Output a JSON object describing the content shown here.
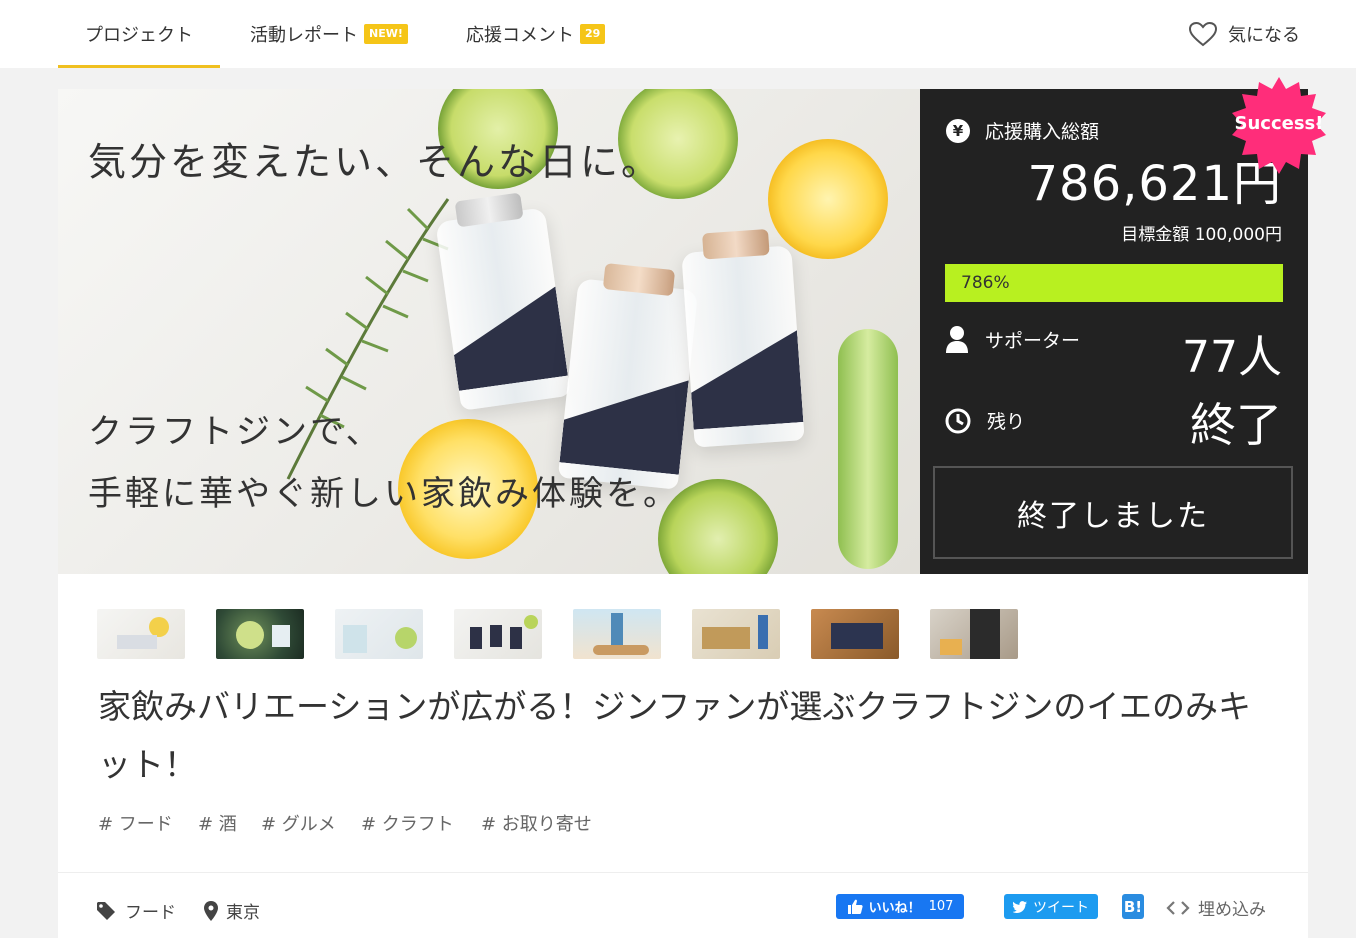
{
  "nav": {
    "tabs": [
      {
        "label": "プロジェクト"
      },
      {
        "label": "活動レポート",
        "badge": "NEW!"
      },
      {
        "label": "応援コメント",
        "badge": "29"
      }
    ],
    "favorite_label": "気になる"
  },
  "hero": {
    "headline": "気分を変えたい、そんな日に。",
    "line1": "クラフトジンで、",
    "line2": "手軽に華やぐ新しい家飲み体験を。"
  },
  "stats": {
    "total_label": "応援購入総額",
    "total_value": "786,621円",
    "goal_text": "目標金額 100,000円",
    "percent_text": "786%",
    "supporters_label": "サポーター",
    "supporters_value": "77人",
    "remaining_label": "残り",
    "remaining_value": "終了",
    "ended_button": "終了しました",
    "success_badge": "Success!"
  },
  "thumbnails": [
    {
      "name": "thumbnail-1"
    },
    {
      "name": "thumbnail-2"
    },
    {
      "name": "thumbnail-3"
    },
    {
      "name": "thumbnail-4"
    },
    {
      "name": "thumbnail-5"
    },
    {
      "name": "thumbnail-6"
    },
    {
      "name": "thumbnail-7"
    },
    {
      "name": "thumbnail-8"
    }
  ],
  "project": {
    "title": "家飲みバリエーションが広がる！ジンファンが選ぶクラフトジンのイエのみキット！",
    "tags": [
      "# フード",
      "# 酒",
      "# グルメ",
      "# クラフト",
      "# お取り寄せ"
    ]
  },
  "footer": {
    "category": "フード",
    "location": "東京",
    "like_label": "いいね！",
    "like_count": "107",
    "tweet_label": "ツイート",
    "hatena_label": "B!",
    "embed_label": "埋め込み"
  },
  "colors": {
    "accent": "#f5c518",
    "progress": "#b8f020",
    "success_badge": "#ff2d7a",
    "stats_bg": "#222222"
  }
}
